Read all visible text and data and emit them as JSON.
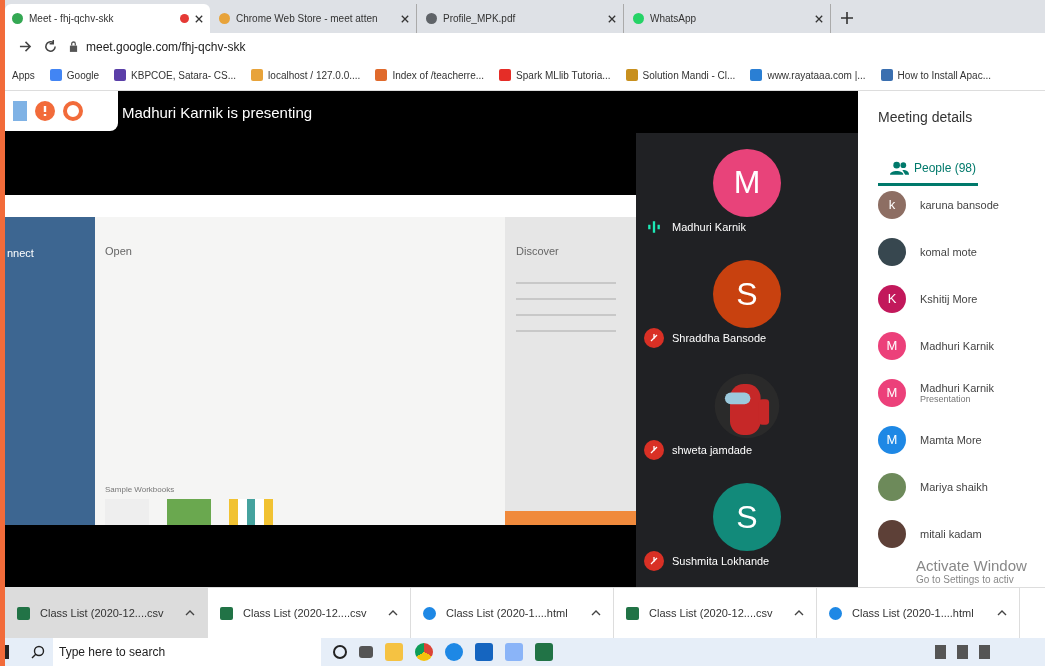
{
  "browser": {
    "tabs": [
      {
        "title": "Meet - fhj-qchv-skk",
        "selected": true,
        "recording": true,
        "kind": "meet"
      },
      {
        "title": "Chrome Web Store - meet atten",
        "selected": false,
        "recording": false,
        "kind": "store"
      },
      {
        "title": "Profile_MPK.pdf",
        "selected": false,
        "recording": false,
        "kind": "globe"
      },
      {
        "title": "WhatsApp",
        "selected": false,
        "recording": false,
        "kind": "whatsapp"
      }
    ],
    "url": "meet.google.com/fhj-qchv-skk",
    "bookmarks": [
      {
        "label": "Apps"
      },
      {
        "label": "Google",
        "color": "#4285f4"
      },
      {
        "label": "KBPCOE, Satara- CS...",
        "color": "#5b3fa8"
      },
      {
        "label": "localhost / 127.0.0....",
        "color": "#e8a33a"
      },
      {
        "label": "Index of /teacherre...",
        "color": "#e06a2c"
      },
      {
        "label": "Spark MLlib Tutoria...",
        "color": "#e52d27"
      },
      {
        "label": "Solution Mandi - Cl...",
        "color": "#c8901e"
      },
      {
        "label": "www.rayataaa.com |...",
        "color": "#2a7fd4"
      },
      {
        "label": "How to Install Apac...",
        "color": "#3a6fb0"
      }
    ]
  },
  "meet": {
    "presenting": "Madhuri Karnik is presenting",
    "shared_screen": {
      "sidebar": [
        "nnect"
      ],
      "open_title": "Open",
      "discover_title": "Discover",
      "samples_title": "Sample Workbooks"
    },
    "tiles": [
      {
        "name": "Madhuri Karnik",
        "initial": "M",
        "color": "#e8437a",
        "kind": "letter",
        "muted": false
      },
      {
        "name": "Shraddha Bansode",
        "initial": "S",
        "color": "#c8410f",
        "kind": "letter",
        "muted": true
      },
      {
        "name": "shweta jamdade",
        "color": "#c62828",
        "kind": "picture",
        "muted": true
      },
      {
        "name": "Sushmita Lokhande",
        "initial": "S",
        "color": "#128a7a",
        "kind": "letter",
        "muted": true
      }
    ],
    "details": {
      "title": "Meeting details",
      "tab": "People (98)",
      "people": [
        {
          "name": "karuna bansode",
          "initial": "k",
          "color": "#8d6e63",
          "kind": "letter"
        },
        {
          "name": "komal mote",
          "color": "#37474f",
          "kind": "photo"
        },
        {
          "name": "Kshitij More",
          "initial": "K",
          "color": "#c2185b",
          "kind": "letter"
        },
        {
          "name": "Madhuri Karnik",
          "initial": "M",
          "color": "#ec407a",
          "kind": "letter"
        },
        {
          "name": "Madhuri Karnik",
          "initial": "M",
          "color": "#ec407a",
          "kind": "letter",
          "subtitle": "Presentation"
        },
        {
          "name": "Mamta More",
          "initial": "M",
          "color": "#1e88e5",
          "kind": "letter"
        },
        {
          "name": "Mariya shaikh",
          "color": "#6d8a5a",
          "kind": "photo"
        },
        {
          "name": "mitali kadam",
          "color": "#5d4037",
          "kind": "photo"
        }
      ]
    }
  },
  "downloads": [
    {
      "label": "Class List (2020-12....csv",
      "kind": "csv",
      "selected": true
    },
    {
      "label": "Class List (2020-12....csv",
      "kind": "csv",
      "selected": false
    },
    {
      "label": "Class List (2020-1....html",
      "kind": "html",
      "selected": false
    },
    {
      "label": "Class List (2020-12....csv",
      "kind": "csv",
      "selected": false
    },
    {
      "label": "Class List (2020-1....html",
      "kind": "html",
      "selected": false
    }
  ],
  "activation": {
    "title": "Activate Window",
    "subtitle": "Go to Settings to activ"
  },
  "taskbar": {
    "search_placeholder": "Type here to search"
  }
}
